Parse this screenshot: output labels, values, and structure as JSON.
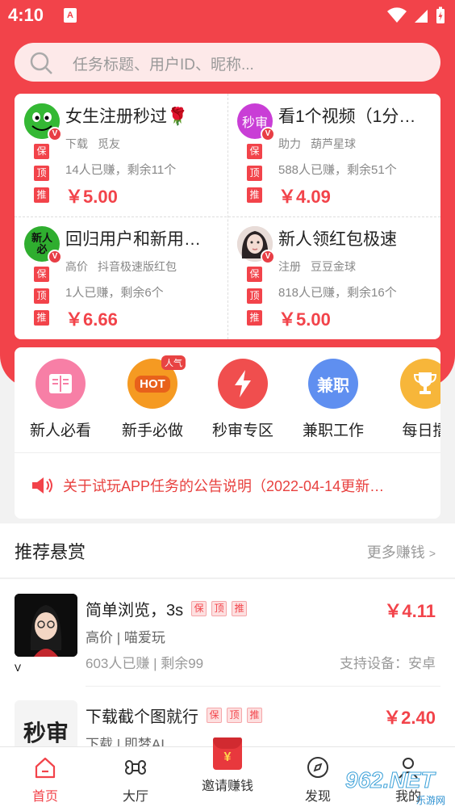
{
  "status_bar": {
    "time": "4:10",
    "sim_label": "A"
  },
  "search": {
    "placeholder": "任务标题、用户ID、昵称..."
  },
  "featured_tasks": [
    {
      "title": "女生注册秒过🌹",
      "category": "下载",
      "app": "觅友",
      "stats": "14人已赚，剩余11个",
      "price": "￥5.00",
      "tags": [
        "保",
        "顶",
        "推"
      ],
      "avatar_icon": "smiley-face-icon",
      "avatar_color": "#3dbb3d"
    },
    {
      "title": "看1个视频（1分…",
      "category": "助力",
      "app": "葫芦星球",
      "stats": "588人已赚，剩余51个",
      "price": "￥4.09",
      "tags": [
        "保",
        "顶",
        "推"
      ],
      "avatar_text": "秒审",
      "avatar_color": "#c93ed6"
    },
    {
      "title": "回归用户和新用…",
      "category": "高价",
      "app": "抖音极速版红包",
      "stats": "1人已赚，剩余6个",
      "price": "￥6.66",
      "tags": [
        "保",
        "顶",
        "推"
      ],
      "avatar_text": "新人必",
      "avatar_color": "#2fae2f"
    },
    {
      "title": "新人领红包极速",
      "category": "注册",
      "app": "豆豆金球",
      "stats": "818人已赚，剩余16个",
      "price": "￥5.00",
      "tags": [
        "保",
        "顶",
        "推"
      ],
      "avatar_icon": "girl-portrait-icon",
      "avatar_color": "#d9c6c2"
    }
  ],
  "categories": [
    {
      "label": "新人必看",
      "icon": "book-icon",
      "color": "#f77fa6"
    },
    {
      "label": "新手必做",
      "icon": "hot-flame-icon",
      "color": "#f59a22",
      "badge": "人气",
      "icon_text": "HOT"
    },
    {
      "label": "秒审专区",
      "icon": "lightning-icon",
      "color": "#f04e4e"
    },
    {
      "label": "兼职工作",
      "icon": "job-icon",
      "color": "#5f8ff0",
      "icon_text": "兼职"
    },
    {
      "label": "每日擂",
      "icon": "trophy-icon",
      "color": "#f7b63a"
    }
  ],
  "notice": {
    "text": "关于试玩APP任务的公告说明（2022-04-14更新…"
  },
  "recommended": {
    "title": "推荐悬赏",
    "more": "更多赚钱",
    "more_arrow": ">",
    "items": [
      {
        "title": "简单浏览，3s",
        "tags": [
          "保",
          "顶",
          "推"
        ],
        "sub": "高价 | 喵爱玩",
        "stat": "603人已赚 |  剩余99",
        "price": "￥4.11",
        "device": "支持设备：安卓",
        "thumb_icon": "cartoon-girl-icon"
      },
      {
        "title": "下载截个图就行",
        "tags": [
          "保",
          "顶",
          "推"
        ],
        "sub": "下载 | 即梦AI",
        "price": "￥2.40",
        "thumb_text": "秒审"
      }
    ]
  },
  "tabbar": {
    "items": [
      {
        "label": "首页",
        "icon": "home-icon",
        "active": true
      },
      {
        "label": "大厅",
        "icon": "command-icon"
      },
      {
        "label": "邀请赚钱",
        "icon": "red-packet-icon",
        "packet_text": "¥"
      },
      {
        "label": "发现",
        "icon": "compass-icon"
      },
      {
        "label": "我的",
        "icon": "user-icon"
      }
    ]
  },
  "watermark": {
    "main": "962.NET",
    "sub": "乐游网"
  }
}
